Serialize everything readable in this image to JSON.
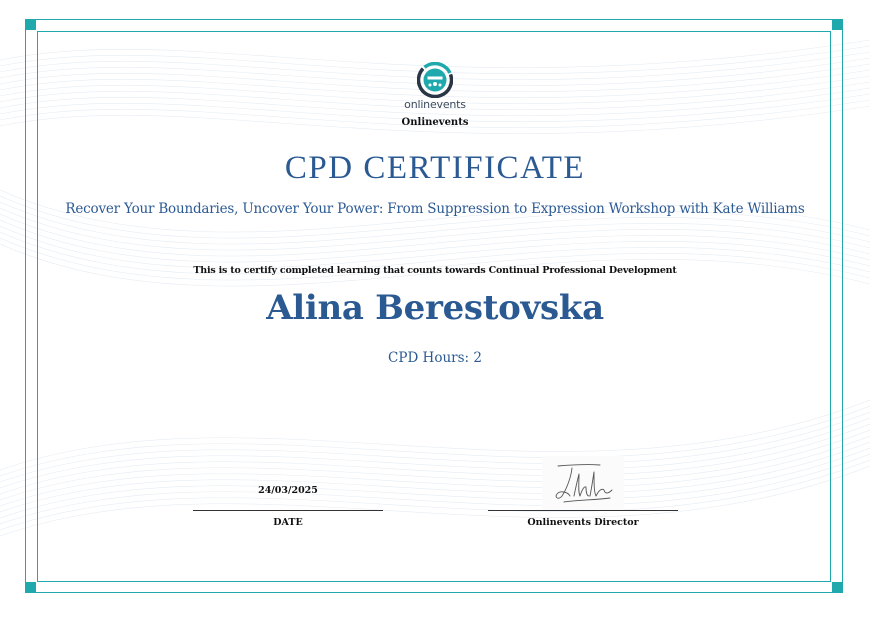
{
  "logo": {
    "wordmark": "onlinevents",
    "icon": "onlinevents-logo-icon"
  },
  "organization": "Onlinevents",
  "certificate": {
    "title": "CPD CERTIFICATE",
    "course": "Recover Your Boundaries, Uncover Your Power: From Suppression to Expression Workshop with Kate Williams",
    "certify_statement": "This is to certify completed learning that counts towards Continual Professional Development",
    "recipient": "Alina Berestovska",
    "cpd_hours": "CPD Hours: 2"
  },
  "footer": {
    "date_value": "24/03/2025",
    "date_caption": "DATE",
    "signatory_caption": "Onlinevents Director",
    "signature_icon": "handwritten-signature"
  },
  "colors": {
    "frame": "#1fa9ad",
    "heading_blue": "#2b5a93",
    "text_dark": "#111111"
  }
}
